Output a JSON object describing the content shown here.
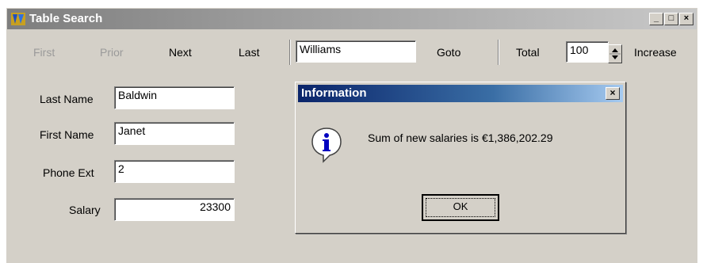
{
  "window": {
    "title": "Table Search",
    "minimize": "_",
    "maximize": "□",
    "close": "×"
  },
  "toolbar": {
    "first": "First",
    "prior": "Prior",
    "next": "Next",
    "last": "Last",
    "search_value": "Williams",
    "goto": "Goto",
    "total": "Total",
    "percent_value": "100",
    "increase": "Increase"
  },
  "form": {
    "last_name_label": "Last Name",
    "last_name_value": "Baldwin",
    "first_name_label": "First Name",
    "first_name_value": "Janet",
    "phone_ext_label": "Phone Ext",
    "phone_ext_value": "2",
    "salary_label": "Salary",
    "salary_value": "23300"
  },
  "dialog": {
    "title": "Information",
    "close": "×",
    "message": "Sum of new salaries is €1,386,202.29",
    "ok": "OK"
  }
}
